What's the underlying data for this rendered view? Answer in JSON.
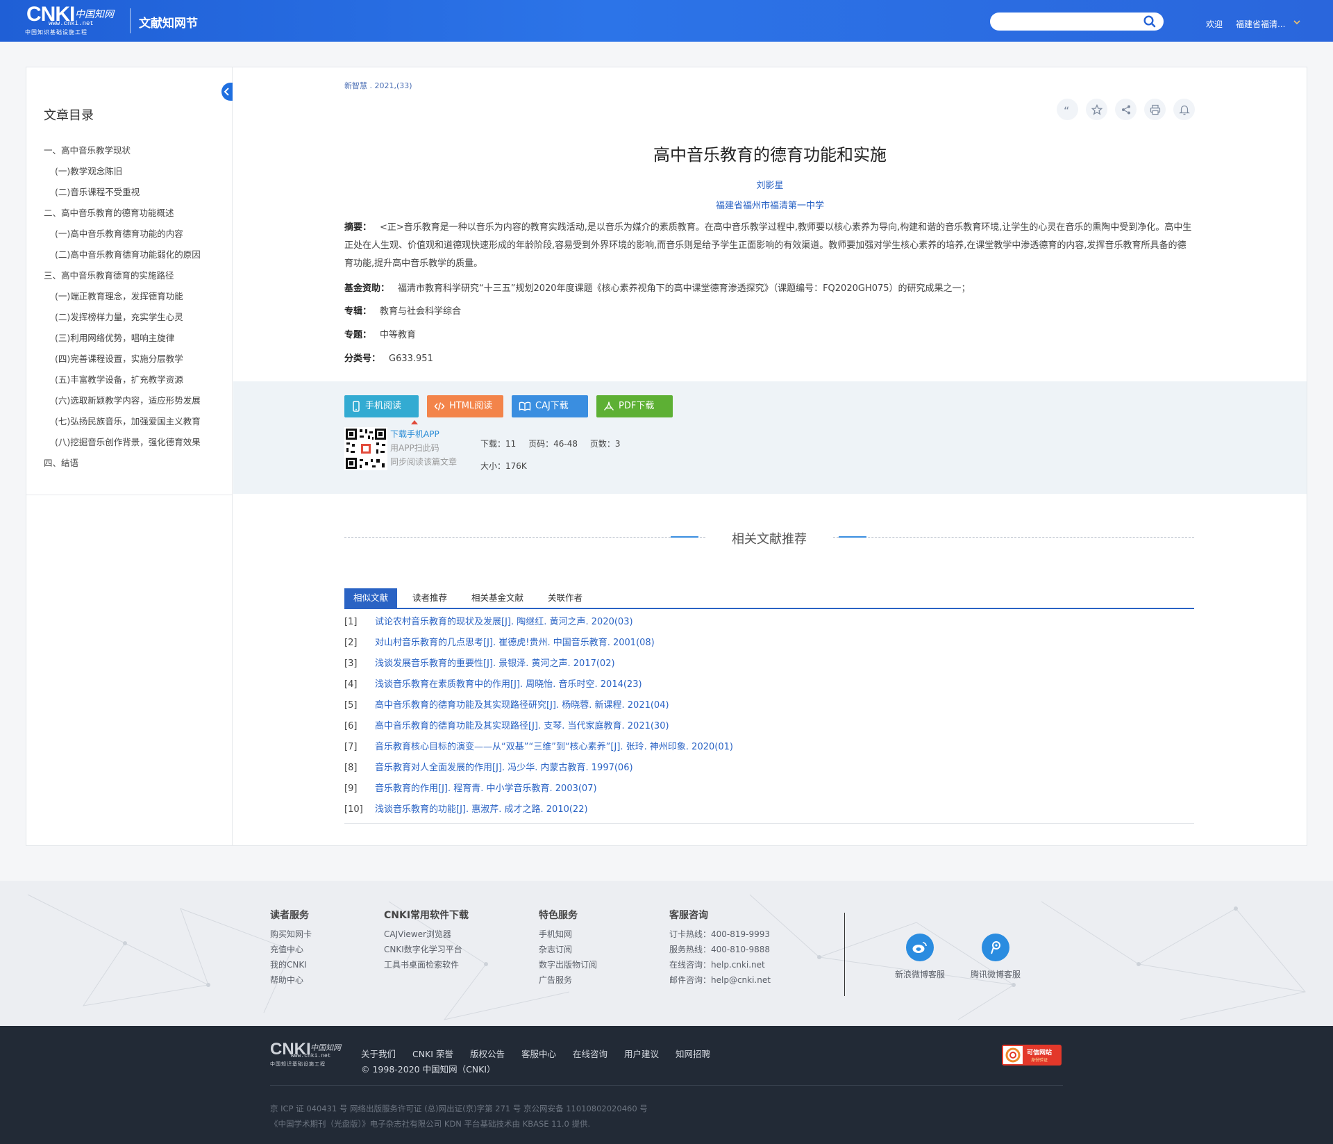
{
  "header": {
    "logo_main": "CNKI",
    "logo_cn": "中国知网",
    "logo_url": "www.cnki.net",
    "logo_sub": "中国知识基础设施工程",
    "site_name": "文献知网节",
    "search_placeholder": "",
    "welcome": "欢迎",
    "user": "福建省福清..."
  },
  "sidebar": {
    "title": "文章目录",
    "items": [
      {
        "label": "一、高中音乐教学现状",
        "level": 1
      },
      {
        "label": "(一)教学观念陈旧",
        "level": 2
      },
      {
        "label": "(二)音乐课程不受重视",
        "level": 2
      },
      {
        "label": "二、高中音乐教育的德育功能概述",
        "level": 1
      },
      {
        "label": "(一)高中音乐教育德育功能的内容",
        "level": 2
      },
      {
        "label": "(二)高中音乐教育德育功能弱化的原因",
        "level": 2
      },
      {
        "label": "三、高中音乐教育德育的实施路径",
        "level": 1
      },
      {
        "label": "(一)端正教育理念，发挥德育功能",
        "level": 2
      },
      {
        "label": "(二)发挥榜样力量，充实学生心灵",
        "level": 2
      },
      {
        "label": "(三)利用网络优势，唱响主旋律",
        "level": 2
      },
      {
        "label": "(四)完善课程设置，实施分层教学",
        "level": 2
      },
      {
        "label": "(五)丰富教学设备，扩充教学资源",
        "level": 2
      },
      {
        "label": "(六)选取新颖教学内容，适应形势发展",
        "level": 2
      },
      {
        "label": "(七)弘扬民族音乐，加强爱国主义教育",
        "level": 2
      },
      {
        "label": "(八)挖掘音乐创作背景，强化德育效果",
        "level": 2
      },
      {
        "label": "四、结语",
        "level": 1
      }
    ]
  },
  "article": {
    "journal_ref": "新智慧 . 2021,(33)",
    "title": "高中音乐教育的德育功能和实施",
    "author": "刘影星",
    "affiliation": "福建省福州市福清第一中学",
    "abstract_label": "摘要：",
    "abstract": "<正>音乐教育是一种以音乐为内容的教育实践活动,是以音乐为媒介的素质教育。在高中音乐教学过程中,教师要以核心素养为导向,构建和谐的音乐教育环境,让学生的心灵在音乐的熏陶中受到净化。高中生正处在人生观、价值观和道德观快速形成的年龄阶段,容易受到外界环境的影响,而音乐则是给予学生正面影响的有效渠道。教师要加强对学生核心素养的培养,在课堂教学中渗透德育的内容,发挥音乐教育所具备的德育功能,提升高中音乐教学的质量。",
    "fund_label": "基金资助：",
    "fund": "福清市教育科学研究“十三五”规划2020年度课题《核心素养视角下的高中课堂德育渗透探究》（课题编号：FQ2020GH075）的研究成果之一；",
    "album_label": "专辑：",
    "album": "教育与社会科学综合",
    "topic_label": "专题：",
    "topic": "中等教育",
    "clc_label": "分类号：",
    "clc": "G633.951"
  },
  "download": {
    "btn_mobile": "手机阅读",
    "btn_html": "HTML阅读",
    "btn_caj": "CAJ下载",
    "btn_pdf": "PDF下载",
    "app_link": "下载手机APP",
    "app_hint1": "用APP扫此码",
    "app_hint2": "同步阅读该篇文章",
    "downloads": "下载：11",
    "pages_range": "页码：46-48",
    "page_count": "页数：3",
    "size": "大小：176K"
  },
  "related": {
    "section_title": "相关文献推荐",
    "tabs": [
      "相似文献",
      "读者推荐",
      "相关基金文献",
      "关联作者"
    ],
    "active_tab": 0,
    "refs": [
      {
        "num": "[1]",
        "text": "试论农村音乐教育的现状及发展[J]. 陶继红.  黄河之声. 2020(03)"
      },
      {
        "num": "[2]",
        "text": "对山村音乐教育的几点思考[J]. 崔德虎!贵州.  中国音乐教育. 2001(08)"
      },
      {
        "num": "[3]",
        "text": "浅谈发展音乐教育的重要性[J]. 景银泽.  黄河之声. 2017(02)"
      },
      {
        "num": "[4]",
        "text": "浅谈音乐教育在素质教育中的作用[J]. 周晓怡.  音乐时空. 2014(23)"
      },
      {
        "num": "[5]",
        "text": "高中音乐教育的德育功能及其实现路径研究[J]. 杨晓蓉.  新课程. 2021(04)"
      },
      {
        "num": "[6]",
        "text": "高中音乐教育的德育功能及其实现路径[J]. 支琴.  当代家庭教育. 2021(30)"
      },
      {
        "num": "[7]",
        "text": "音乐教育核心目标的演变——从“双基”“三维”到“核心素养”[J]. 张玲.  神州印象. 2020(01)"
      },
      {
        "num": "[8]",
        "text": "音乐教育对人全面发展的作用[J]. 冯少华.  内蒙古教育. 1997(06)"
      },
      {
        "num": "[9]",
        "text": "音乐教育的作用[J]. 程育青.  中小学音乐教育. 2003(07)"
      },
      {
        "num": "[10]",
        "text": "浅谈音乐教育的功能[J]. 惠淑芹.  成才之路. 2010(22)"
      }
    ]
  },
  "footer": {
    "cols": [
      {
        "title": "读者服务",
        "items": [
          "购买知网卡",
          "充值中心",
          "我的CNKI",
          "帮助中心"
        ]
      },
      {
        "title": "CNKI常用软件下载",
        "items": [
          "CAJViewer浏览器",
          "CNKI数字化学习平台",
          "工具书桌面检索软件"
        ]
      },
      {
        "title": "特色服务",
        "items": [
          "手机知网",
          "杂志订阅",
          "数字出版物订阅",
          "广告服务"
        ]
      },
      {
        "title": "客服咨询",
        "items": [
          "订卡热线：400-819-9993",
          "服务热线：400-810-9888",
          "在线咨询：help.cnki.net",
          "邮件咨询：help@cnki.net"
        ]
      }
    ],
    "weibo_sina": "新浪微博客服",
    "weibo_tencent": "腾讯微博客服",
    "links": [
      "关于我们",
      "CNKI 荣誉",
      "版权公告",
      "客服中心",
      "在线咨询",
      "用户建议",
      "知网招聘"
    ],
    "copyright": "© 1998-2020 中国知网（CNKI）",
    "badge_text": "可信网站",
    "badge_sub": "身份验证",
    "icp1": "京 ICP 证 040431 号 网络出版服务许可证 (总)网出证(京)字第 271 号 京公网安备 11010802020460 号",
    "icp2": "《中国学术期刊（光盘版）》电子杂志社有限公司 KDN 平台基础技术由 KBASE 11.0 提供."
  },
  "colors": {
    "header_blue": "#2c74e8",
    "link_blue": "#2a63c4",
    "btn_mobile": "#33abd2",
    "btn_html": "#f3844a",
    "btn_caj": "#3a8ee0",
    "btn_pdf": "#5db034",
    "footer_dark": "#222a36"
  }
}
